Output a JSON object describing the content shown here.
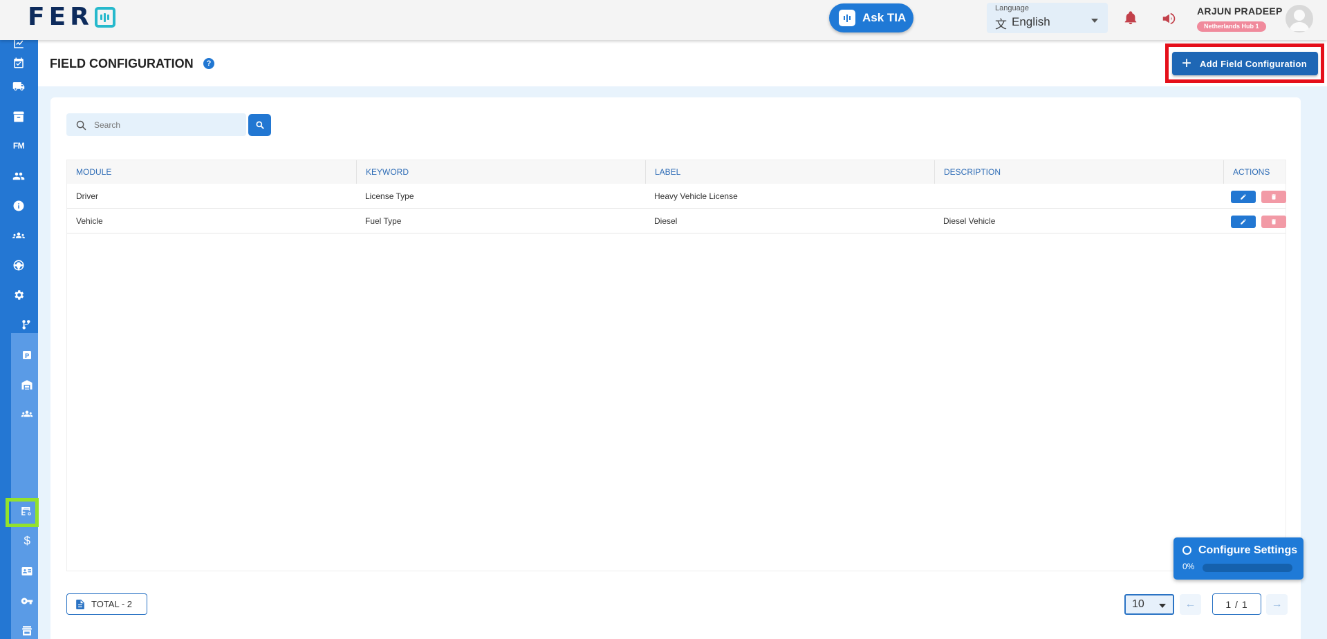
{
  "header": {
    "logo_text": "FER",
    "ask_label": "Ask TIA",
    "language_caption": "Language",
    "language_value": "English",
    "user_name": "ARJUN PRADEEP",
    "user_hub": "Netherlands Hub 1"
  },
  "sidebar": {
    "items": [
      {
        "icon": "dashboard-chart-icon"
      },
      {
        "icon": "calendar-check-icon"
      },
      {
        "icon": "truck-icon"
      },
      {
        "icon": "archive-box-icon"
      },
      {
        "icon": "fm-text-icon",
        "label": "FM"
      },
      {
        "icon": "users-icon"
      },
      {
        "icon": "info-icon"
      },
      {
        "icon": "team-icon"
      },
      {
        "icon": "steering-wheel-icon"
      },
      {
        "icon": "gear-icon"
      },
      {
        "icon": "route-branch-icon"
      },
      {
        "icon": "parking-icon",
        "label": "P"
      },
      {
        "icon": "warehouse-icon"
      },
      {
        "icon": "group-icon"
      },
      {
        "icon": "field-configuration-icon",
        "active": true
      },
      {
        "icon": "dollar-icon",
        "label": "$"
      },
      {
        "icon": "id-card-icon"
      },
      {
        "icon": "key-icon"
      },
      {
        "icon": "store-icon"
      },
      {
        "icon": "note-edit-icon"
      }
    ]
  },
  "page": {
    "title": "FIELD CONFIGURATION",
    "help": "?",
    "add_button_label": "Add Field Configuration"
  },
  "search": {
    "placeholder": "Search",
    "value": ""
  },
  "table": {
    "columns": [
      "MODULE",
      "KEYWORD",
      "LABEL",
      "DESCRIPTION",
      "ACTIONS"
    ],
    "rows": [
      {
        "module": "Driver",
        "keyword": "License Type",
        "label": "Heavy Vehicle License",
        "description": ""
      },
      {
        "module": "Vehicle",
        "keyword": "Fuel Type",
        "label": "Diesel",
        "description": "Diesel Vehicle"
      }
    ]
  },
  "footer": {
    "total_label": "TOTAL  - 2",
    "page_size": "10",
    "page_indicator": "1 / 1"
  },
  "config_widget": {
    "title": "Configure Settings",
    "progress_label": "0%",
    "progress": 0
  },
  "colors": {
    "primary": "#2277d2",
    "sidebar_dark": "#2477d3",
    "sidebar_light": "#5a9be6",
    "active_highlight": "#93e22b",
    "red_highlight": "#e50f1a",
    "delete": "#f29aa6"
  }
}
